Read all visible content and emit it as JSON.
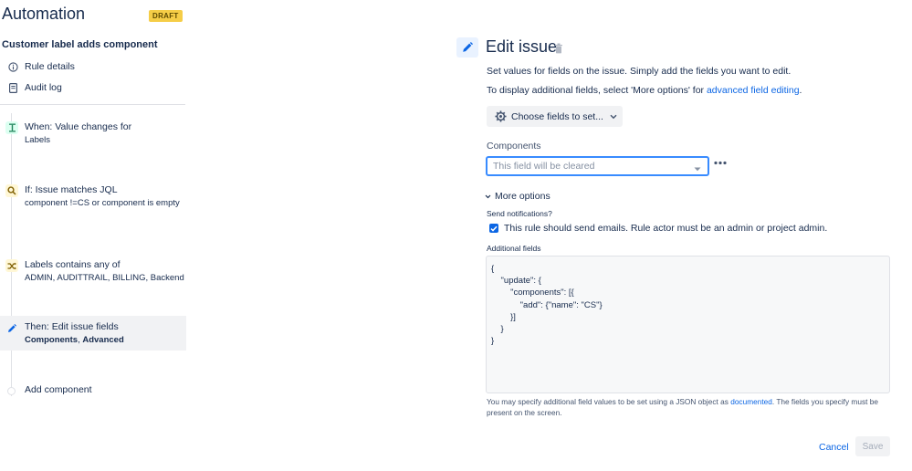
{
  "app": {
    "title": "Automation",
    "badge": "DRAFT"
  },
  "rule": {
    "name": "Customer label adds component"
  },
  "nav": {
    "rule_details": "Rule details",
    "audit_log": "Audit log"
  },
  "steps": [
    {
      "title": "When: Value changes for",
      "subtitle": "Labels",
      "icon": "trigger-icon"
    },
    {
      "title": "If: Issue matches JQL",
      "subtitle": "component !=CS or component is empty",
      "icon": "search-icon"
    },
    {
      "title": "Labels contains any of",
      "subtitle": "ADMIN, AUDITTRAIL, BILLING, Backend",
      "icon": "branch-icon"
    },
    {
      "title": "Then: Edit issue fields",
      "subtitle_bold": "Components",
      "subtitle_sep": ",",
      "subtitle_bold2": "Advanced",
      "icon": "pencil-icon"
    }
  ],
  "add_component": "Add component",
  "panel": {
    "title": "Edit issue",
    "desc1": "Set values for fields on the issue. Simply add the fields you want to edit.",
    "desc2_prefix": "To display additional fields, select 'More options' for ",
    "desc2_link": "advanced field editing",
    "desc2_suffix": ".",
    "choose_fields": "Choose fields to set...",
    "components_label": "Components",
    "components_placeholder": "This field will be cleared",
    "more_options": "More options",
    "send_notifications": "Send notifications?",
    "send_emails_text": "This rule should send emails. Rule actor must be an admin or project admin.",
    "send_emails_checked": true,
    "additional_fields_label": "Additional fields",
    "json": "{\n    \"update\": {\n        \"components\": [{\n            \"add\": {\"name\": \"CS\"}\n        }]\n    }\n}",
    "help_prefix": "You may specify additional field values to be set using a JSON object as ",
    "help_link": "documented",
    "help_suffix": ". The fields you specify must be present on the screen.",
    "cancel": "Cancel",
    "save": "Save"
  },
  "colors": {
    "accent": "#0c66e4",
    "badge": "#f5cd47",
    "selected_row": "#f1f2f4"
  }
}
